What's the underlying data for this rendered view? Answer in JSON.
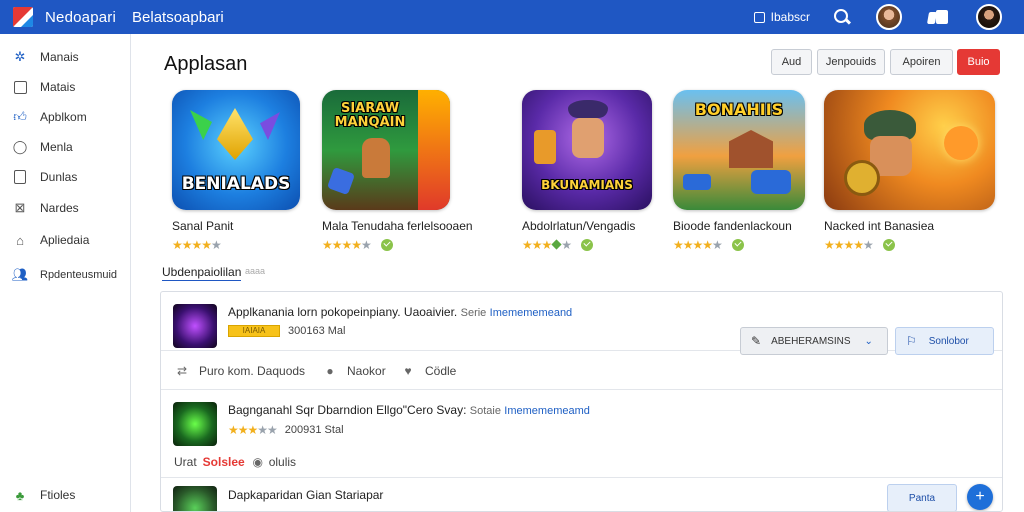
{
  "topbar": {
    "brand": "Nedoapari",
    "brand_sub": "Belatsoapbari",
    "action_label": "Ibabscr"
  },
  "sidebar": {
    "items": [
      {
        "label": "Manais",
        "icon": "gear-icon"
      },
      {
        "label": "Matais",
        "icon": "box-icon"
      },
      {
        "label": "Apblkom",
        "icon": "thumbs-up-icon"
      },
      {
        "label": "Menla",
        "icon": "chat-icon"
      },
      {
        "label": "Dunlas",
        "icon": "document-icon"
      },
      {
        "label": "Nardes",
        "icon": "image-icon"
      },
      {
        "label": "Apliedaia",
        "icon": "home-icon"
      },
      {
        "label": "Rpdenteusmuid",
        "icon": "users-icon"
      }
    ],
    "footer": {
      "label": "Ftioles",
      "icon": "leaf-icon"
    }
  },
  "header": {
    "title": "Applasan",
    "buttons": [
      "Aud",
      "Jenpouids",
      "Apoiren",
      "Buio"
    ]
  },
  "featured": [
    {
      "name": "Sanal Panit",
      "tile_text": "BENIALADS",
      "rating": 4.5,
      "verified": false
    },
    {
      "name": "Mala Tenudaha  ferlelsooaen",
      "tile_text": "SIARAW MANQAIN",
      "rating": 4.5,
      "verified": true
    },
    {
      "name": "Abdolrlatun/Vengadis",
      "tile_text": "BKUNAMIANS",
      "rating": 4.0,
      "verified": true
    },
    {
      "name": "Bioode fandenlackoun",
      "tile_text": "BONAHIIS",
      "rating": 4.5,
      "verified": true
    },
    {
      "name": "Nacked  int  Banasiea",
      "tile_text": "",
      "rating": 4.5,
      "verified": true
    }
  ],
  "section": {
    "label": "Ubdenpaiolilan",
    "extra": "aaaa"
  },
  "list": [
    {
      "title": "Applkanania  lorn  pokopeinpiany. Uaoaivier.",
      "dim": "Serie",
      "link": "Imemememeand",
      "badge": "IAIAIA",
      "meta": "300163 Mal",
      "actions": [
        "Puro kom. Daquods",
        "Naokor",
        "Cödle"
      ],
      "btn_primary": "ABEHERAMSINS",
      "btn_secondary": "Sonlobor"
    },
    {
      "title": "Bagnganahl Sqr Dbarndion  Ellgo\"Cero Svay:",
      "dim": "Sotaie",
      "link": "Imemememeamd",
      "rating": 3.5,
      "meta": "200931 Stal",
      "actions_prefix": "Urat",
      "actions_red": "Solslee",
      "actions_tail": "olulis"
    },
    {
      "title": "Dapkaparidan  Gian  Stariapar",
      "btn": "Panta"
    }
  ],
  "colors": {
    "accent": "#1f57c3",
    "danger": "#e53935",
    "star": "#f2b01e",
    "verified": "#8bc34a"
  }
}
